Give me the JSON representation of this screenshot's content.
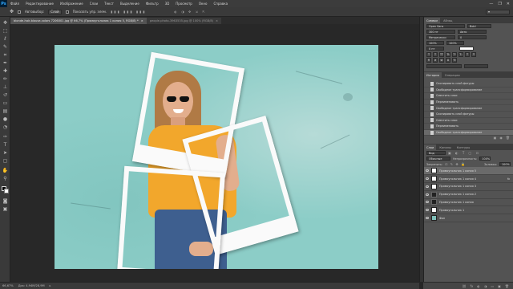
{
  "app": {
    "logo": "Ps"
  },
  "menu": [
    "Файл",
    "Редактирование",
    "Изображение",
    "Слои",
    "Текст",
    "Выделение",
    "Фильтр",
    "3D",
    "Просмотр",
    "Окно",
    "Справка"
  ],
  "window_controls": [
    "—",
    "❐",
    "✕"
  ],
  "options_bar": {
    "autoselect_label": "Автовыбор:",
    "autoselect_value": "Слой",
    "transform_label": "Показать упр. элем."
  },
  "doc_tabs": [
    {
      "label": "blonde-hair-blouse-colors 7206001.jpg @ 66,7% (Прямоугольник 1 копия 5, RGB/8) *",
      "close": "×"
    },
    {
      "label": "people-photo-3963535.jpg @ 100% (RGB/8)",
      "close": "×"
    }
  ],
  "right_panels": {
    "character_tabs": [
      "Символ",
      "Абзац"
    ],
    "character_fields": [
      "Open Sans",
      "Bold",
      "300 пт",
      "Авто",
      "Метрически",
      "0",
      "100%",
      "100%",
      "0 пт"
    ],
    "history_tabs": [
      "История",
      "Операции"
    ],
    "history_items": [
      "Скопировать слой фигуры",
      "Свободное трансформирование",
      "Сместить слои",
      "Переименовать",
      "Свободное трансформирование",
      "Скопировать слой фигуры",
      "Сместить слои",
      "Переименовать",
      "Свободное трансформирование"
    ],
    "layers_tabs": [
      "Слои",
      "Каналы",
      "Контуры"
    ],
    "layers_kind": "Вид",
    "layers_blend": "Обычные",
    "layers_opacity_label": "Непрозрачность:",
    "layers_opacity": "100%",
    "layers_lock_label": "Закрепить:",
    "layers_fill_label": "Заливка:",
    "layers_fill": "100%",
    "layers": [
      {
        "name": "Прямоугольник 1 копия 5",
        "fx": ""
      },
      {
        "name": "Прямоугольник 1 копия 4",
        "fx": "fx"
      },
      {
        "name": "Прямоугольник 1 копия 3",
        "fx": ""
      },
      {
        "name": "Прямоугольник 1 копия 2",
        "fx": ""
      },
      {
        "name": "Прямоугольник 1 копия",
        "fx": ""
      },
      {
        "name": "Прямоугольник 1",
        "fx": ""
      },
      {
        "name": "Фон",
        "fx": ""
      }
    ]
  },
  "status": {
    "zoom": "66,67%",
    "doc_size": "Док: 4,94M/28,9M"
  }
}
